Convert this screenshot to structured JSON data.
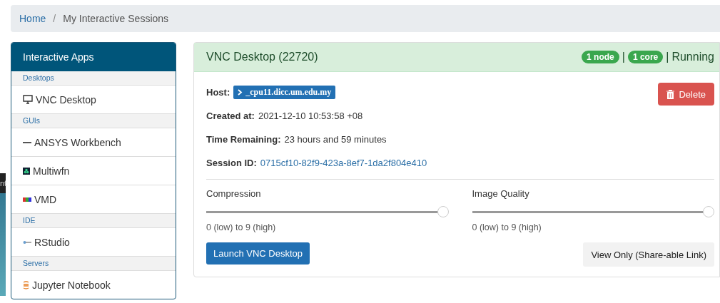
{
  "breadcrumb_separator": "/",
  "status_separator": "|",
  "breadcrumb": [
    {
      "label": "Home",
      "kind": "link"
    },
    {
      "label": "My Interactive Sessions",
      "kind": "current"
    }
  ],
  "background_window": {
    "text": "nt"
  },
  "sidebar": {
    "title": "Interactive Apps",
    "groups": [
      {
        "header": "Desktops",
        "items": [
          {
            "label": "VNC Desktop",
            "kind": "monitor"
          }
        ]
      },
      {
        "header": "GUIs",
        "items": [
          {
            "label": "ANSYS Workbench",
            "kind": "dash"
          },
          {
            "label": "Multiwfn",
            "kind": "multiwfn"
          },
          {
            "label": "VMD",
            "kind": "vmd"
          }
        ]
      },
      {
        "header": "IDE",
        "items": [
          {
            "label": "RStudio",
            "kind": "rstudio"
          }
        ]
      },
      {
        "header": "Servers",
        "items": [
          {
            "label": "Jupyter Notebook",
            "kind": "jupyter"
          }
        ]
      }
    ]
  },
  "session": {
    "title": "VNC Desktop (22720)",
    "badges": [
      "1 node",
      "1 core"
    ],
    "status": "Running",
    "delete_button": "Delete",
    "fields": [
      {
        "label": "Host:",
        "value": "_cpu11.dicc.um.edu.my",
        "kind": "host"
      },
      {
        "label": "Created at:",
        "value": "2021-12-10 10:53:58 +08",
        "kind": "text"
      },
      {
        "label": "Time Remaining:",
        "value": "23 hours and 59 minutes",
        "kind": "text"
      },
      {
        "label": "Session ID:",
        "value": "0715cf10-82f9-423a-8ef7-1da2f804e410",
        "kind": "link"
      }
    ],
    "sliders": [
      {
        "label": "Compression",
        "level": 1.0,
        "hint": "0 (low) to 9 (high)"
      },
      {
        "label": "Image Quality",
        "level": 1.0,
        "hint": "0 (low) to 9 (high)"
      }
    ],
    "launch_button": "Launch VNC Desktop",
    "view_only_button": "View Only (Share-able Link)"
  }
}
